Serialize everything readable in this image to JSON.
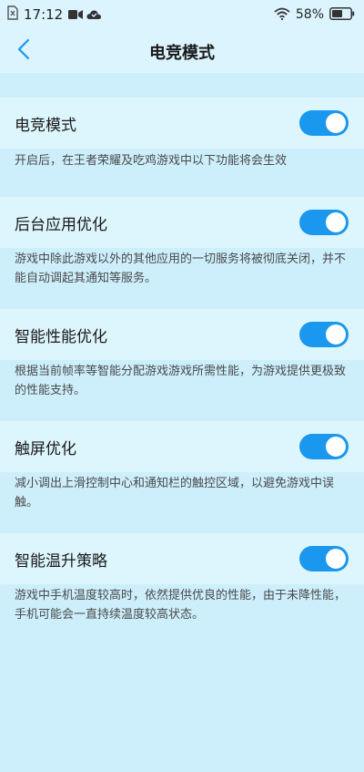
{
  "status_bar": {
    "time": "17:12",
    "battery_percent": "58%",
    "battery_level": 0.58,
    "icons": [
      "sim-icon",
      "video-recording-icon",
      "cloud-icon",
      "wifi-icon",
      "battery-icon"
    ]
  },
  "header": {
    "title": "电竞模式",
    "back_icon": "chevron-left-icon"
  },
  "colors": {
    "accent": "#1a97ee",
    "background": "#cdeffc",
    "row_background": "#ddf5fd"
  },
  "settings": [
    {
      "label": "电竞模式",
      "enabled": true,
      "description": "开启后，在王者荣耀及吃鸡游戏中以下功能将会生效"
    },
    {
      "label": "后台应用优化",
      "enabled": true,
      "description": "游戏中除此游戏以外的其他应用的一切服务将被彻底关闭，并不能自动调起其通知等服务。"
    },
    {
      "label": "智能性能优化",
      "enabled": true,
      "description": "根据当前帧率等智能分配游戏游戏所需性能，为游戏提供更极致的性能支持。"
    },
    {
      "label": "触屏优化",
      "enabled": true,
      "description": "减小调出上滑控制中心和通知栏的触控区域，以避免游戏中误触。"
    },
    {
      "label": "智能温升策略",
      "enabled": true,
      "description": "游戏中手机温度较高时，依然提供优良的性能，由于未降性能，手机可能会一直持续温度较高状态。"
    }
  ]
}
